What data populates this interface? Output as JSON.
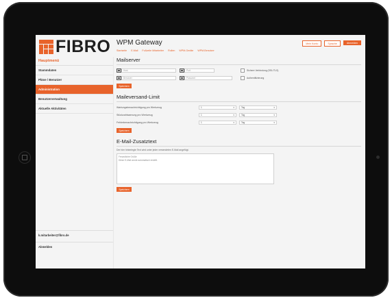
{
  "brand": {
    "logo_text": "FIBRO",
    "app_title": "WPM Gateway",
    "accent_color": "#e8632b",
    "logo_icon": "fibro-grid-icon"
  },
  "header": {
    "tabs": [
      "Startseite",
      "E-Mail",
      "Fußzeile Mitarbeiter",
      "Rollen",
      "WPM-Geräte",
      "WPM-Benutzer"
    ],
    "buttons": {
      "account": "Mein Konto",
      "language": "Sprache",
      "logout": "Abmelden"
    }
  },
  "sidebar": {
    "heading": "Hauptmenü",
    "items": [
      {
        "label": "Stammdaten",
        "active": false
      },
      {
        "label": "Pläne / Benutzer",
        "active": false
      },
      {
        "label": "Administration",
        "active": true
      },
      {
        "label": "Benutzerverwaltung",
        "active": false
      },
      {
        "label": "Aktuelle Aktivitäten",
        "active": false
      }
    ],
    "email": "k.mitarbeiter@fibro.de",
    "logout": "Abmelden"
  },
  "mailserver": {
    "title": "Mailserver",
    "host_placeholder": "Host",
    "port_placeholder": "Port",
    "user_placeholder": "Benutzer",
    "password_placeholder": "Passwort",
    "ssl_label": "Sichere Verbindung (SSL/TLS)",
    "auth_label": "Authentifizierung",
    "save": "Speichern"
  },
  "limit": {
    "title": "Maileversand-Limit",
    "rows": [
      {
        "label": "Wartungsbenachrichtigung pro Werkzeug",
        "value": "1",
        "unit": "Tag"
      },
      {
        "label": "Stückzahlwarnung pro Werkzeug",
        "value": "1",
        "unit": "Tag"
      },
      {
        "label": "Fehlerbenachrichtigung pro Werkzeug",
        "value": "1",
        "unit": "Tag"
      }
    ],
    "save": "Speichern"
  },
  "extra_text": {
    "title": "E-Mail-Zusatztext",
    "help": "Der hier hinterlegte Text wird unter jeder versendeten E-Mail angefügt.",
    "content": "Freundliche Grüße\nDiese E-Mail wurde automatisch erstellt.",
    "save": "Speichern"
  }
}
